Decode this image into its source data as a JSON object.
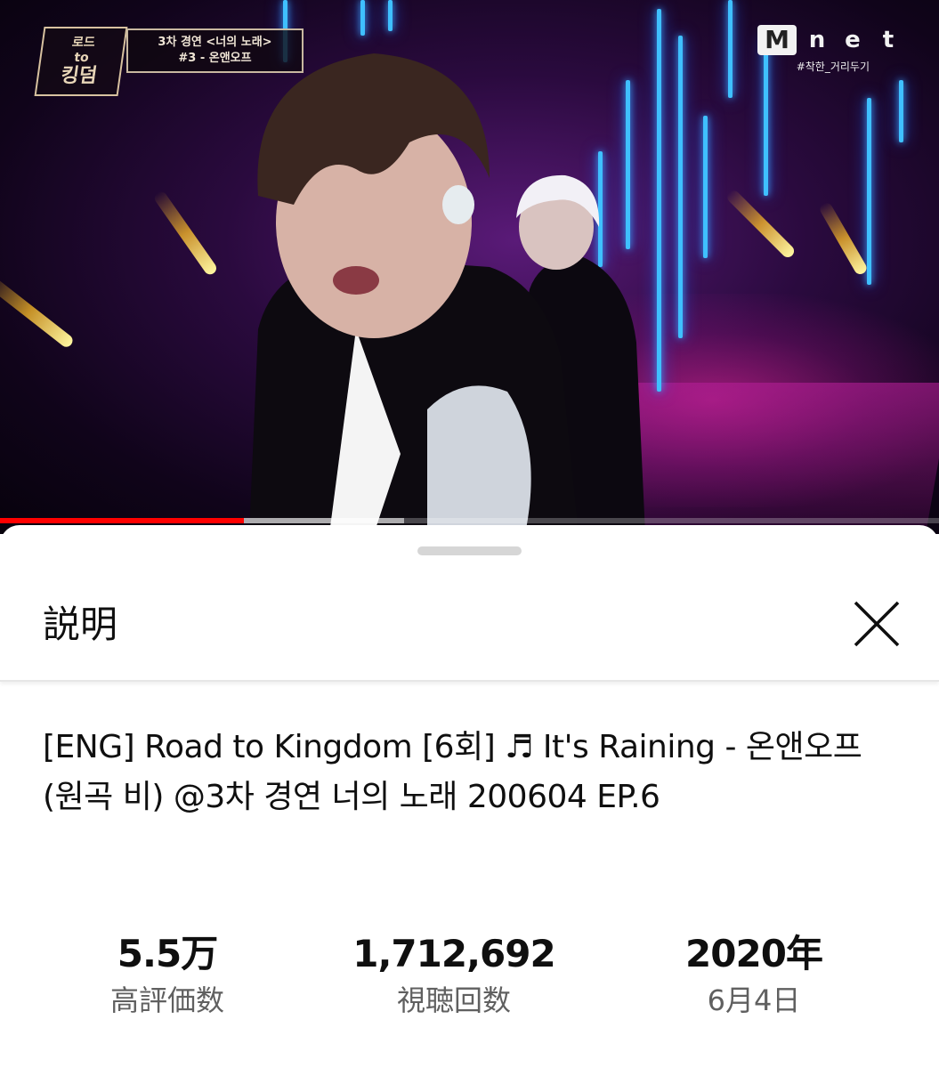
{
  "video": {
    "show_badge": [
      "로드",
      "to",
      "킹덤"
    ],
    "caption_line1": "3차 경연 <너의 노래>",
    "caption_line2": "#3 - 온앤오프",
    "channel_logo_box": "M",
    "channel_logo_letters": [
      "n",
      "e",
      "t"
    ],
    "channel_sub": "#착한_거리두기",
    "progress": 0.26,
    "buffered": 0.43,
    "colors": {
      "progress": "#ff0000",
      "neon": "#3fc0ff"
    }
  },
  "sheet": {
    "title": "説明",
    "close_icon": "close-icon",
    "video_title": "[ENG] Road to Kingdom [6회] ♬ It's Raining - 온앤오프 (원곡  비) @3차 경연 너의 노래 200604 EP.6",
    "stats": [
      {
        "value": "5.5万",
        "label": "高評価数"
      },
      {
        "value": "1,712,692",
        "label": "視聴回数"
      },
      {
        "value": "2020年",
        "label": "6月4日"
      }
    ]
  }
}
